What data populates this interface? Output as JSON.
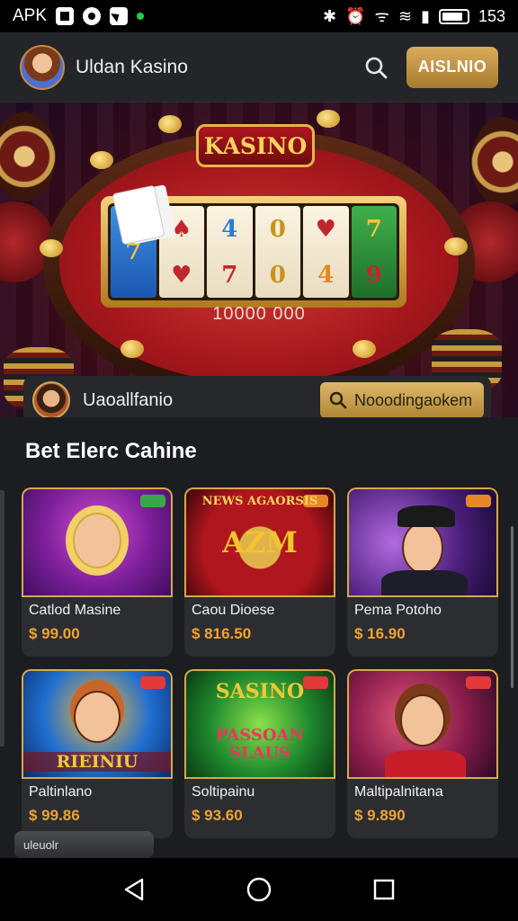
{
  "status_bar": {
    "carrier": "APK",
    "battery": "153"
  },
  "header": {
    "title": "Uldan Kasino",
    "cta_label": "AISLNIO"
  },
  "hero": {
    "logo_text": "KASINO",
    "jackpot": "10000 000",
    "user_name": "Uaoallfanio",
    "search_label": "Nooodingaokem",
    "reels": [
      [
        "7"
      ],
      [
        "♠",
        "♥"
      ],
      [
        "4",
        "7"
      ],
      [
        "0",
        "0"
      ],
      [
        "♥",
        "4"
      ],
      [
        "7",
        "9"
      ]
    ]
  },
  "section": {
    "title": "Bet Elerc Cahine"
  },
  "games": [
    {
      "title": "Catlod Masine",
      "price": "$ 99.00",
      "art": "t1",
      "badge": "green",
      "art_text": ""
    },
    {
      "title": "Caou Dioese",
      "price": "$ 816.50",
      "art": "t2",
      "badge": "orange",
      "art_text": "AZM"
    },
    {
      "title": "Pema Potoho",
      "price": "$ 16.90",
      "art": "t3",
      "badge": "orange",
      "art_text": ""
    },
    {
      "title": "Paltinlano",
      "price": "$ 99.86",
      "art": "t4",
      "badge": "red",
      "art_text": "RIEINIU"
    },
    {
      "title": "Soltipainu",
      "price": "$ 93.60",
      "art": "t5",
      "badge": "red",
      "art_text": "PASSOAN SLAUS"
    },
    {
      "title": "Maltipalnitana",
      "price": "$ 9.890",
      "art": "t6",
      "badge": "red",
      "art_text": ""
    }
  ],
  "games_extra": {
    "card2_banner": "NEWS AGAORSIS",
    "card5_banner": "SASINO"
  },
  "mini_bar": {
    "label": "uleuolr"
  },
  "colors": {
    "accent_gold": "#d4a756",
    "price_orange": "#f0a332",
    "background": "#1b1d20"
  }
}
